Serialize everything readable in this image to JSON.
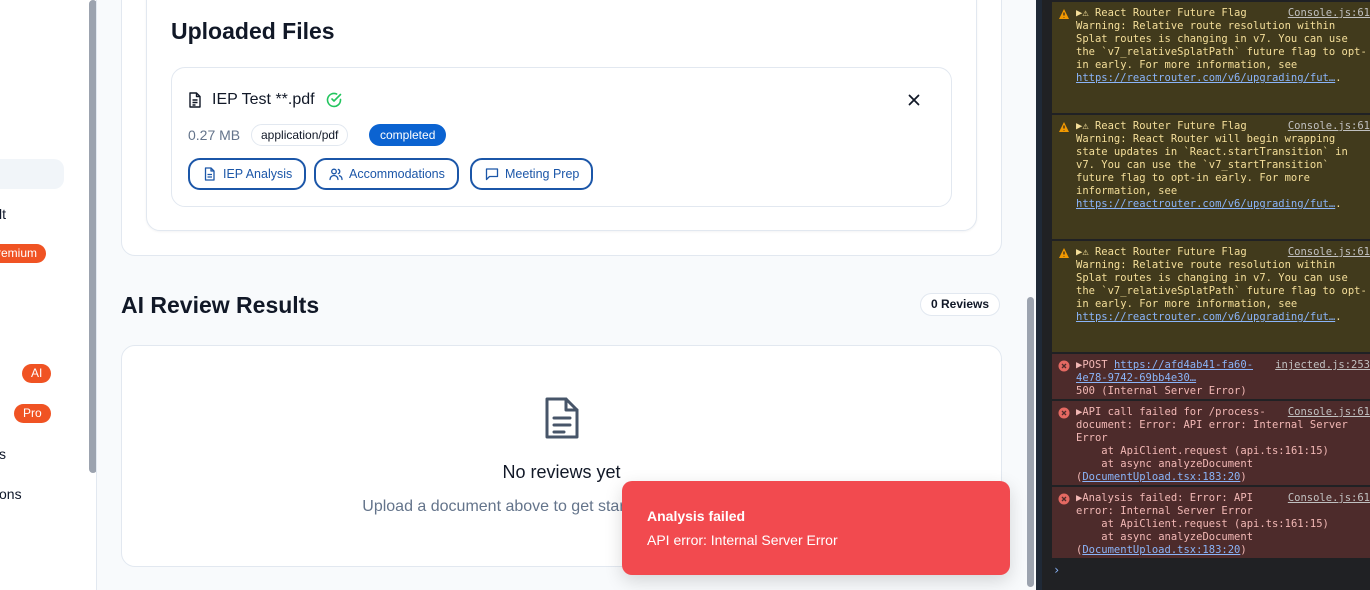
{
  "sidebar": {
    "items": [
      {
        "label": "lt"
      },
      {
        "badge": "remium"
      },
      {
        "badge": "AI"
      },
      {
        "badge": "Pro"
      },
      {
        "label": "s"
      },
      {
        "label": "ons"
      }
    ]
  },
  "uploaded": {
    "title": "Uploaded Files",
    "file": {
      "name": "IEP Test **.pdf",
      "size": "0.27 MB",
      "mime": "application/pdf",
      "status": "completed",
      "actions": [
        {
          "label": "IEP Analysis",
          "icon": "file-text-icon"
        },
        {
          "label": "Accommodations",
          "icon": "users-icon"
        },
        {
          "label": "Meeting Prep",
          "icon": "message-square-icon"
        }
      ]
    }
  },
  "reviews": {
    "title": "AI Review Results",
    "count": "0 Reviews",
    "empty_title": "No reviews yet",
    "empty_subtitle": "Upload a document above to get started with AI analysis"
  },
  "toast": {
    "title": "Analysis failed",
    "message": "API error: Internal Server Error"
  },
  "console": {
    "messages": [
      {
        "level": "warn",
        "source": "Console.js:61",
        "text": "▶⚠ React Router Future Flag Warning: Relative route resolution within Splat routes is changing in v7. You can use the `v7_relativeSplatPath` future flag to opt-in early. For more information, see ",
        "link": "https://reactrouter.com/v6/upgrading/fut…",
        "tail": "."
      },
      {
        "level": "warn",
        "source": "Console.js:61",
        "text": "▶⚠ React Router Future Flag Warning: React Router will begin wrapping state updates in `React.startTransition` in v7. You can use the `v7_startTransition` future flag to opt-in early. For more information, see ",
        "link": "https://reactrouter.com/v6/upgrading/fut…",
        "tail": "."
      },
      {
        "level": "warn",
        "source": "Console.js:61",
        "text": "▶⚠ React Router Future Flag Warning: Relative route resolution within Splat routes is changing in v7. You can use the `v7_relativeSplatPath` future flag to opt-in early. For more information, see ",
        "link": "https://reactrouter.com/v6/upgrading/fut…",
        "tail": "."
      },
      {
        "level": "error",
        "source": "injected.js:253",
        "text": "▶POST ",
        "link": "https://afd4ab41-fa60-4e78-9742-69bb4e30…",
        "tail": "\n500 (Internal Server Error)"
      },
      {
        "level": "error",
        "source": "Console.js:61",
        "text": "▶API call failed for /process-document: Error: API error: Internal Server Error\n    at ApiClient.request (api.ts:161:15)\n    at async analyzeDocument (",
        "link": "DocumentUpload.tsx:183:20",
        "tail": ")"
      },
      {
        "level": "error",
        "source": "Console.js:61",
        "text": "▶Analysis failed: Error: API error: Internal Server Error\n    at ApiClient.request (api.ts:161:15)\n    at async analyzeDocument (",
        "link": "DocumentUpload.tsx:183:20",
        "tail": ")"
      }
    ],
    "prompt": "›"
  },
  "colors": {
    "accent": "#1b56a8",
    "status_badge": "#0b63d1",
    "brand_badge": "#f05323",
    "toast_bg": "#f24a4f",
    "success": "#22c55e"
  }
}
